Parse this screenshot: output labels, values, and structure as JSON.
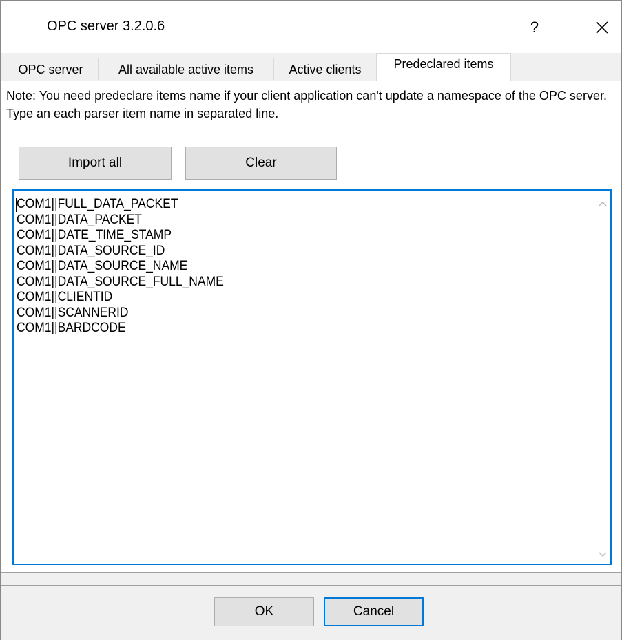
{
  "window": {
    "title": "OPC server 3.2.0.6",
    "help_label": "?"
  },
  "tabs": [
    {
      "label": "OPC server",
      "active": false
    },
    {
      "label": "All available active items",
      "active": false
    },
    {
      "label": "Active clients",
      "active": false
    },
    {
      "label": "Predeclared items",
      "active": true
    }
  ],
  "panel": {
    "note": "Note: You need predeclare items name if your client application can't update a namespace of the OPC server. Type an each parser item name in separated line.",
    "import_all_label": "Import all",
    "clear_label": "Clear",
    "items": [
      "COM1||FULL_DATA_PACKET",
      "COM1||DATA_PACKET",
      "COM1||DATE_TIME_STAMP",
      "COM1||DATA_SOURCE_ID",
      "COM1||DATA_SOURCE_NAME",
      "COM1||DATA_SOURCE_FULL_NAME",
      "COM1||CLIENTID",
      "COM1||SCANNERID",
      "COM1||BARDCODE"
    ]
  },
  "footer": {
    "ok_label": "OK",
    "cancel_label": "Cancel"
  },
  "colors": {
    "focus_border": "#0078d7",
    "button_face": "#e1e1e1",
    "dialog_bg": "#f0f0f0"
  }
}
